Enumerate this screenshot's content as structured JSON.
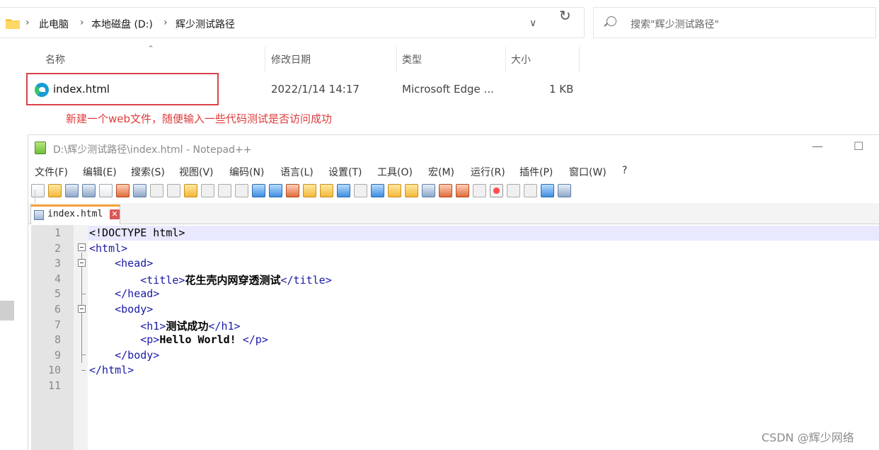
{
  "explorer": {
    "breadcrumb": [
      "此电脑",
      "本地磁盘 (D:)",
      "辉少测试路径"
    ],
    "breadcrumb_sep": "›",
    "search_placeholder": "搜索\"辉少测试路径\"",
    "columns": [
      "名称",
      "修改日期",
      "类型",
      "大小"
    ],
    "file": {
      "name": "index.html",
      "modified": "2022/1/14 14:17",
      "type": "Microsoft Edge ...",
      "size": "1 KB"
    },
    "annotation": "新建一个web文件，随便输入一些代码测试是否访问成功",
    "highlight_color": "#d9434b"
  },
  "notepad": {
    "title": "D:\\辉少测试路径\\index.html - Notepad++",
    "window_buttons": [
      "—",
      "☐"
    ],
    "menu": [
      "文件(F)",
      "编辑(E)",
      "搜索(S)",
      "视图(V)",
      "编码(N)",
      "语言(L)",
      "设置(T)",
      "工具(O)",
      "宏(M)",
      "运行(R)",
      "插件(P)",
      "窗口(W)",
      "?"
    ],
    "tab": {
      "label": "index.html",
      "close": "✕"
    },
    "lines": [
      {
        "n": "1",
        "code": "<!DOCTYPE html>"
      },
      {
        "n": "2",
        "code": "<html>"
      },
      {
        "n": "3",
        "code": "    <head>"
      },
      {
        "n": "4",
        "tag_open": "        <title>",
        "text": "花生壳内网穿透测试",
        "tag_close": "</title>"
      },
      {
        "n": "5",
        "code": "    </head>"
      },
      {
        "n": "6",
        "code": "    <body>"
      },
      {
        "n": "7",
        "tag_open": "        <h1>",
        "text": "测试成功",
        "tag_close": "</h1>"
      },
      {
        "n": "8",
        "tag_open": "        <p>",
        "text": "Hello World! ",
        "tag_close": "</p>"
      },
      {
        "n": "9",
        "code": "    </body>"
      },
      {
        "n": "10",
        "code": "</html>"
      },
      {
        "n": "11",
        "code": ""
      }
    ]
  },
  "watermark": "CSDN @辉少网络"
}
